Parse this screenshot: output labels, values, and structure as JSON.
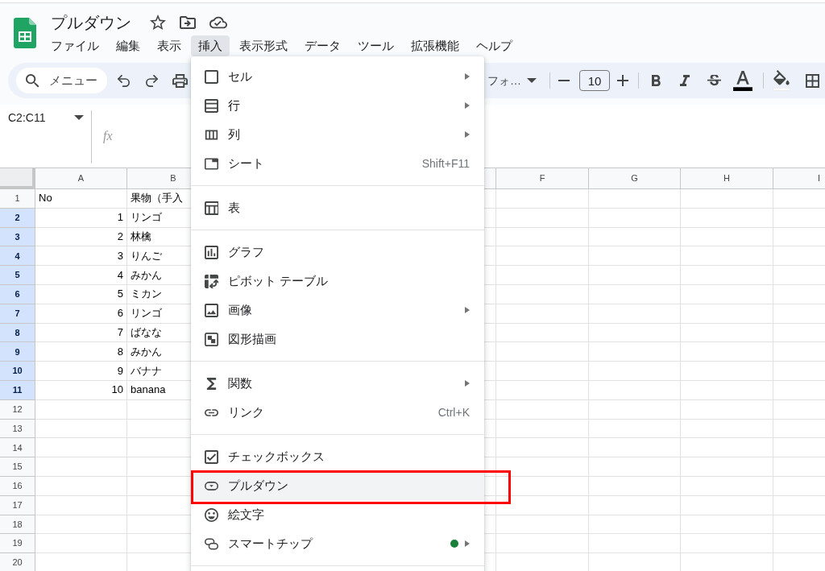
{
  "document": {
    "title": "プルダウン"
  },
  "menubar": [
    {
      "label": "ファイル",
      "selected": false
    },
    {
      "label": "編集",
      "selected": false
    },
    {
      "label": "表示",
      "selected": false
    },
    {
      "label": "挿入",
      "selected": true
    },
    {
      "label": "表示形式",
      "selected": false
    },
    {
      "label": "データ",
      "selected": false
    },
    {
      "label": "ツール",
      "selected": false
    },
    {
      "label": "拡張機能",
      "selected": false
    },
    {
      "label": "ヘルプ",
      "selected": false
    }
  ],
  "toolbar": {
    "search": {
      "placeholder": "メニュー"
    },
    "font": "フォ…",
    "font_size": "10"
  },
  "name_box": "C2:C11",
  "formula_bar": {
    "function_label": "fx"
  },
  "columns": [
    {
      "label": "A",
      "selected": false
    },
    {
      "label": "B",
      "selected": false
    },
    {
      "label": "F",
      "selected": false
    },
    {
      "label": "G",
      "selected": false
    },
    {
      "label": "H",
      "selected": false
    },
    {
      "label": "I",
      "selected": false
    }
  ],
  "rows": [
    {
      "number": "1",
      "selected": false,
      "cells": [
        {
          "text": "No",
          "kind": "text"
        },
        {
          "text": "果物（手入",
          "kind": "text"
        }
      ]
    },
    {
      "number": "2",
      "selected": true,
      "cells": [
        {
          "text": "1",
          "kind": "number"
        },
        {
          "text": "リンゴ",
          "kind": "text"
        }
      ]
    },
    {
      "number": "3",
      "selected": true,
      "cells": [
        {
          "text": "2",
          "kind": "number"
        },
        {
          "text": "林檎",
          "kind": "text"
        }
      ]
    },
    {
      "number": "4",
      "selected": true,
      "cells": [
        {
          "text": "3",
          "kind": "number"
        },
        {
          "text": "りんご",
          "kind": "text"
        }
      ]
    },
    {
      "number": "5",
      "selected": true,
      "cells": [
        {
          "text": "4",
          "kind": "number"
        },
        {
          "text": "みかん",
          "kind": "text"
        }
      ]
    },
    {
      "number": "6",
      "selected": true,
      "cells": [
        {
          "text": "5",
          "kind": "number"
        },
        {
          "text": "ミカン",
          "kind": "text"
        }
      ]
    },
    {
      "number": "7",
      "selected": true,
      "cells": [
        {
          "text": "6",
          "kind": "number"
        },
        {
          "text": "リンゴ",
          "kind": "text"
        }
      ]
    },
    {
      "number": "8",
      "selected": true,
      "cells": [
        {
          "text": "7",
          "kind": "number"
        },
        {
          "text": "ばなな",
          "kind": "text"
        }
      ]
    },
    {
      "number": "9",
      "selected": true,
      "cells": [
        {
          "text": "8",
          "kind": "number"
        },
        {
          "text": "みかん",
          "kind": "text"
        }
      ]
    },
    {
      "number": "10",
      "selected": true,
      "cells": [
        {
          "text": "9",
          "kind": "number"
        },
        {
          "text": "バナナ",
          "kind": "text"
        }
      ]
    },
    {
      "number": "11",
      "selected": true,
      "cells": [
        {
          "text": "10",
          "kind": "number"
        },
        {
          "text": "banana",
          "kind": "text"
        }
      ]
    },
    {
      "number": "12",
      "selected": false,
      "cells": []
    },
    {
      "number": "13",
      "selected": false,
      "cells": []
    },
    {
      "number": "14",
      "selected": false,
      "cells": []
    },
    {
      "number": "15",
      "selected": false,
      "cells": []
    },
    {
      "number": "16",
      "selected": false,
      "cells": []
    },
    {
      "number": "17",
      "selected": false,
      "cells": []
    },
    {
      "number": "18",
      "selected": false,
      "cells": []
    },
    {
      "number": "19",
      "selected": false,
      "cells": []
    },
    {
      "number": "20",
      "selected": false,
      "cells": []
    }
  ],
  "insert_menu": {
    "sections": [
      {
        "items": [
          {
            "label": "セル",
            "submenu": true,
            "highlighted": false,
            "framed": false
          },
          {
            "label": "行",
            "submenu": true,
            "highlighted": false,
            "framed": false
          },
          {
            "label": "列",
            "submenu": true,
            "highlighted": false,
            "framed": false
          },
          {
            "label": "シート",
            "shortcut": "Shift+F11",
            "submenu": false,
            "highlighted": false,
            "framed": false
          }
        ]
      },
      {
        "items": [
          {
            "label": "表",
            "submenu": false,
            "highlighted": false,
            "framed": false
          }
        ]
      },
      {
        "items": [
          {
            "label": "グラフ",
            "submenu": false,
            "highlighted": false,
            "framed": false
          },
          {
            "label": "ピボット テーブル",
            "submenu": false,
            "highlighted": false,
            "framed": false
          },
          {
            "label": "画像",
            "submenu": true,
            "highlighted": false,
            "framed": false
          },
          {
            "label": "図形描画",
            "submenu": false,
            "highlighted": false,
            "framed": false
          }
        ]
      },
      {
        "items": [
          {
            "label": "関数",
            "submenu": true,
            "highlighted": false,
            "framed": false
          },
          {
            "label": "リンク",
            "shortcut": "Ctrl+K",
            "submenu": false,
            "highlighted": false,
            "framed": false
          }
        ]
      },
      {
        "items": [
          {
            "label": "チェックボックス",
            "submenu": false,
            "highlighted": false,
            "framed": false
          },
          {
            "label": "プルダウン",
            "submenu": false,
            "highlighted": true,
            "framed": true
          },
          {
            "label": "絵文字",
            "submenu": false,
            "highlighted": false,
            "framed": false
          },
          {
            "label": "スマートチップ",
            "submenu": true,
            "color": "#188038",
            "highlighted": false,
            "framed": false
          }
        ]
      }
    ]
  }
}
